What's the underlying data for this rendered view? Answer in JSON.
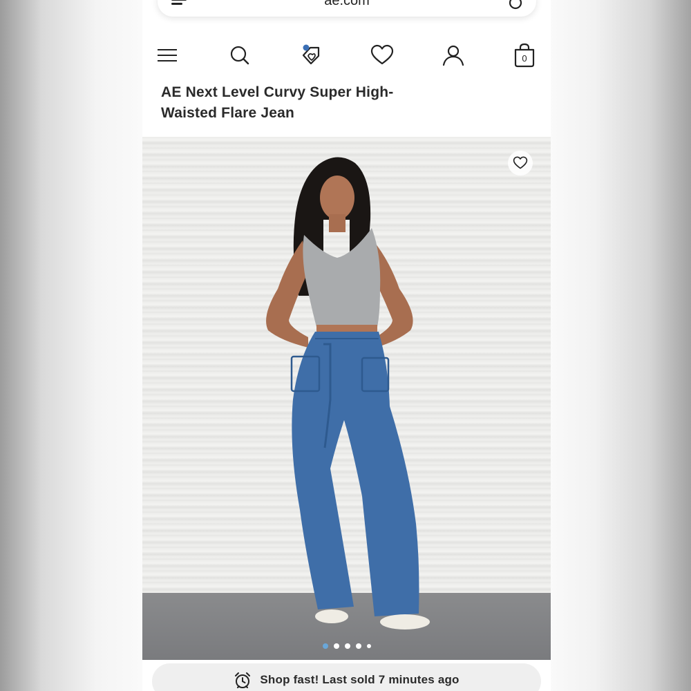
{
  "browser": {
    "url": "ae.com"
  },
  "nav": {
    "icons": [
      "menu-icon",
      "search-icon",
      "rewards-tag-icon",
      "wishlist-heart-icon",
      "account-icon",
      "bag-icon"
    ],
    "bag_count": "0",
    "rewards_dot_color": "#3a6fb5"
  },
  "product": {
    "title_line1": "AE Next Level Curvy Super High-",
    "title_line2": "Waisted Flare Jean"
  },
  "gallery": {
    "slide_count": 5,
    "active_slide": 1,
    "active_dot_color": "#6aa7d8"
  },
  "notice": {
    "text": "Shop fast! Last sold 7 minutes ago",
    "icon": "alarm-clock-icon"
  }
}
